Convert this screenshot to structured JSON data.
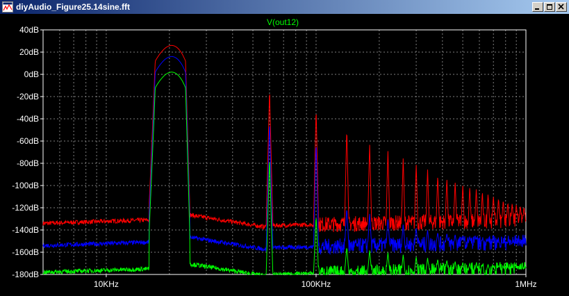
{
  "window": {
    "title": "diyAudio_Figure25.14sine.fft",
    "icons": [
      "app-icon",
      "minimize-icon",
      "restore-icon",
      "close-icon"
    ]
  },
  "chart_data": {
    "type": "line",
    "title": "V(out12)",
    "title_color": "#00ff00",
    "x_scale": "log",
    "xlim_hz": [
      5000,
      1000000
    ],
    "ylim": [
      -180,
      40
    ],
    "grid": true,
    "x_ticks": [
      {
        "value": 10000,
        "label": "10KHz"
      },
      {
        "value": 100000,
        "label": "100KHz"
      },
      {
        "value": 1000000,
        "label": "1MHz"
      }
    ],
    "y_ticks": [
      {
        "value": 40,
        "label": "40dB"
      },
      {
        "value": 20,
        "label": "20dB"
      },
      {
        "value": 0,
        "label": "0dB"
      },
      {
        "value": -20,
        "label": "-20dB"
      },
      {
        "value": -40,
        "label": "-40dB"
      },
      {
        "value": -60,
        "label": "-60dB"
      },
      {
        "value": -80,
        "label": "-80dB"
      },
      {
        "value": -100,
        "label": "-100dB"
      },
      {
        "value": -120,
        "label": "-120dB"
      },
      {
        "value": -140,
        "label": "-140dB"
      },
      {
        "value": -160,
        "label": "-160dB"
      },
      {
        "value": -180,
        "label": "-180dB"
      }
    ],
    "series": [
      {
        "color": "#ff0000",
        "fundamental_hz": 20000,
        "fundamental_db": 32,
        "floor_db": -134,
        "harmonics": [
          {
            "hz": 60000,
            "db": -13
          },
          {
            "hz": 100000,
            "db": -30
          },
          {
            "hz": 140000,
            "db": -48
          },
          {
            "hz": 180000,
            "db": -62
          },
          {
            "hz": 220000,
            "db": -68
          },
          {
            "hz": 260000,
            "db": -75
          },
          {
            "hz": 300000,
            "db": -80
          },
          {
            "hz": 340000,
            "db": -85
          },
          {
            "hz": 380000,
            "db": -90
          },
          {
            "hz": 420000,
            "db": -93
          },
          {
            "hz": 460000,
            "db": -96
          },
          {
            "hz": 500000,
            "db": -99
          },
          {
            "hz": 540000,
            "db": -101
          },
          {
            "hz": 580000,
            "db": -103
          },
          {
            "hz": 620000,
            "db": -105
          },
          {
            "hz": 660000,
            "db": -107
          },
          {
            "hz": 700000,
            "db": -109
          },
          {
            "hz": 740000,
            "db": -111
          },
          {
            "hz": 780000,
            "db": -113
          },
          {
            "hz": 820000,
            "db": -115
          },
          {
            "hz": 860000,
            "db": -116
          },
          {
            "hz": 900000,
            "db": -117
          },
          {
            "hz": 940000,
            "db": -118
          },
          {
            "hz": 980000,
            "db": -119
          }
        ]
      },
      {
        "color": "#0000ff",
        "fundamental_hz": 20000,
        "fundamental_db": 22,
        "floor_db": -154,
        "harmonics": [
          {
            "hz": 60000,
            "db": -42
          },
          {
            "hz": 100000,
            "db": -60
          },
          {
            "hz": 140000,
            "db": -120
          },
          {
            "hz": 180000,
            "db": -125
          },
          {
            "hz": 220000,
            "db": -130
          },
          {
            "hz": 260000,
            "db": -135
          },
          {
            "hz": 300000,
            "db": -138
          },
          {
            "hz": 340000,
            "db": -140
          },
          {
            "hz": 380000,
            "db": -142
          },
          {
            "hz": 420000,
            "db": -143
          },
          {
            "hz": 460000,
            "db": -144
          },
          {
            "hz": 500000,
            "db": -145
          },
          {
            "hz": 540000,
            "db": -146
          },
          {
            "hz": 580000,
            "db": -147
          },
          {
            "hz": 620000,
            "db": -148
          },
          {
            "hz": 660000,
            "db": -149
          },
          {
            "hz": 700000,
            "db": -150
          },
          {
            "hz": 740000,
            "db": -151
          },
          {
            "hz": 780000,
            "db": -152
          },
          {
            "hz": 820000,
            "db": -152
          },
          {
            "hz": 860000,
            "db": -153
          },
          {
            "hz": 900000,
            "db": -153
          },
          {
            "hz": 940000,
            "db": -154
          },
          {
            "hz": 980000,
            "db": -154
          }
        ]
      },
      {
        "color": "#00ff00",
        "fundamental_hz": 20000,
        "fundamental_db": 8,
        "floor_db": -178,
        "harmonics": [
          {
            "hz": 60000,
            "db": -75
          },
          {
            "hz": 100000,
            "db": -127
          },
          {
            "hz": 140000,
            "db": -155
          },
          {
            "hz": 180000,
            "db": -158
          },
          {
            "hz": 220000,
            "db": -160
          },
          {
            "hz": 260000,
            "db": -162
          },
          {
            "hz": 300000,
            "db": -164
          },
          {
            "hz": 340000,
            "db": -165
          },
          {
            "hz": 380000,
            "db": -166
          },
          {
            "hz": 420000,
            "db": -167
          },
          {
            "hz": 460000,
            "db": -168
          },
          {
            "hz": 500000,
            "db": -169
          },
          {
            "hz": 540000,
            "db": -170
          },
          {
            "hz": 580000,
            "db": -170
          },
          {
            "hz": 620000,
            "db": -171
          },
          {
            "hz": 660000,
            "db": -171
          },
          {
            "hz": 700000,
            "db": -172
          },
          {
            "hz": 740000,
            "db": -172
          },
          {
            "hz": 780000,
            "db": -173
          },
          {
            "hz": 820000,
            "db": -173
          },
          {
            "hz": 860000,
            "db": -174
          },
          {
            "hz": 900000,
            "db": -174
          },
          {
            "hz": 940000,
            "db": -175
          },
          {
            "hz": 980000,
            "db": -175
          }
        ]
      }
    ]
  }
}
